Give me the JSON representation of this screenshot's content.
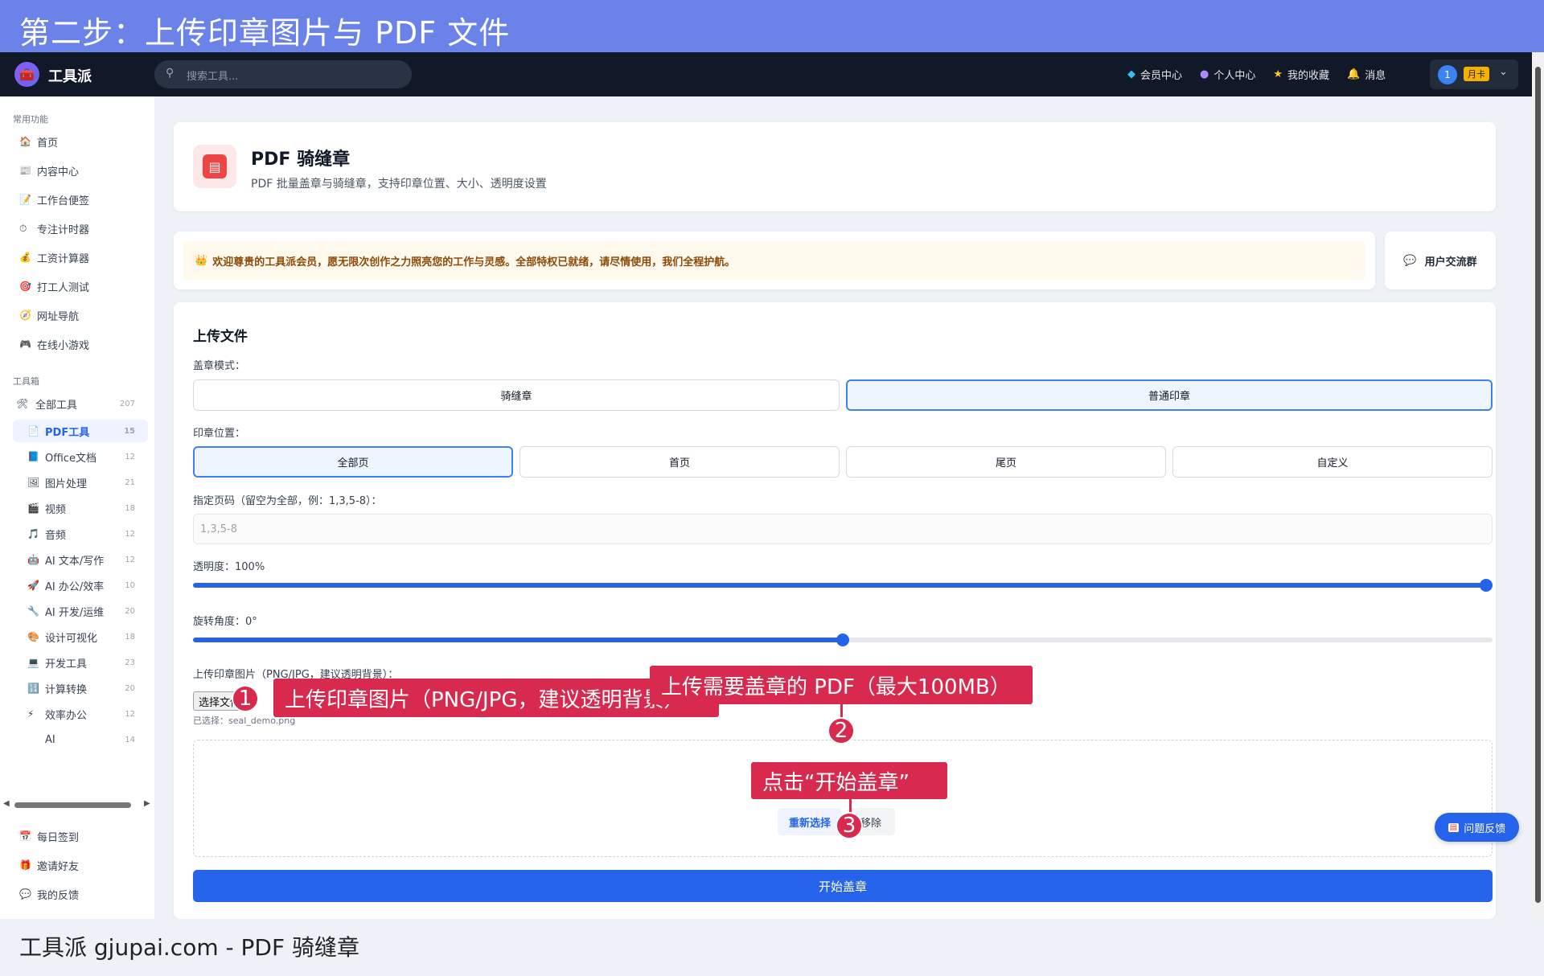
{
  "banner": {
    "title": "第二步：上传印章图片与 PDF 文件"
  },
  "navbar": {
    "app_name": "工具派",
    "search_placeholder": "搜索工具...",
    "links": [
      {
        "label": "会员中心",
        "icon": "diamond-icon"
      },
      {
        "label": "个人中心",
        "icon": "user-icon"
      },
      {
        "label": "我的收藏",
        "icon": "star-icon"
      },
      {
        "label": "消息",
        "icon": "bell-icon"
      }
    ],
    "avatar_text": "1",
    "plan_badge": "月卡"
  },
  "sidebar": {
    "common_title": "常用功能",
    "common": [
      {
        "label": "首页",
        "icon": "🏠"
      },
      {
        "label": "内容中心",
        "icon": "📰"
      },
      {
        "label": "工作台便签",
        "icon": "📝"
      },
      {
        "label": "专注计时器",
        "icon": "⏱"
      },
      {
        "label": "工资计算器",
        "icon": "💰"
      },
      {
        "label": "打工人测试",
        "icon": "🎯"
      },
      {
        "label": "网址导航",
        "icon": "🧭"
      },
      {
        "label": "在线小游戏",
        "icon": "🎮"
      }
    ],
    "toolbox_title": "工具箱",
    "all_tools": {
      "label": "全部工具",
      "count": "207",
      "icon": "🛠"
    },
    "tools": [
      {
        "label": "PDF工具",
        "count": "15",
        "icon": "📄",
        "active": true
      },
      {
        "label": "Office文档",
        "count": "12",
        "icon": "📘"
      },
      {
        "label": "图片处理",
        "count": "21",
        "icon": "🖼"
      },
      {
        "label": "视频",
        "count": "18",
        "icon": "🎬"
      },
      {
        "label": "音频",
        "count": "12",
        "icon": "🎵"
      },
      {
        "label": "AI 文本/写作",
        "count": "12",
        "icon": "🤖"
      },
      {
        "label": "AI 办公/效率",
        "count": "10",
        "icon": "🚀"
      },
      {
        "label": "AI 开发/运维",
        "count": "20",
        "icon": "🔧"
      },
      {
        "label": "设计可视化",
        "count": "18",
        "icon": "🎨"
      },
      {
        "label": "开发工具",
        "count": "23",
        "icon": "💻"
      },
      {
        "label": "计算转换",
        "count": "20",
        "icon": "🔢"
      },
      {
        "label": "效率办公",
        "count": "12",
        "icon": "⚡"
      },
      {
        "label": "AI",
        "count": "14",
        "icon": ""
      }
    ],
    "bottom": [
      {
        "label": "每日签到",
        "icon": "📅"
      },
      {
        "label": "邀请好友",
        "icon": "🎁"
      },
      {
        "label": "我的反馈",
        "icon": "💬"
      }
    ]
  },
  "header_card": {
    "title": "PDF 骑缝章",
    "subtitle": "PDF 批量盖章与骑缝章，支持印章位置、大小、透明度设置"
  },
  "welcome": {
    "text": "欢迎尊贵的工具派会员，愿无限次创作之力照亮您的工作与灵感。全部特权已就绪，请尽情使用，我们全程护航。",
    "group_button": "用户交流群"
  },
  "upload": {
    "section_title": "上传文件",
    "mode_label": "盖章模式：",
    "modes": [
      {
        "label": "骑缝章",
        "selected": false
      },
      {
        "label": "普通印章",
        "selected": true
      }
    ],
    "position_label": "印章位置：",
    "positions": [
      {
        "label": "全部页",
        "selected": true
      },
      {
        "label": "首页",
        "selected": false
      },
      {
        "label": "尾页",
        "selected": false
      },
      {
        "label": "自定义",
        "selected": false
      }
    ],
    "pages_label": "指定页码（留空为全部，例：1,3,5-8）：",
    "pages_placeholder": "1,3,5-8",
    "opacity_label": "透明度：100%",
    "opacity_value": 1.0,
    "rotation_label": "旋转角度：0°",
    "rotation_value": 0.5,
    "seal_label": "上传印章图片（PNG/JPG，建议透明背景）：",
    "choose_file": "选择文件",
    "chosen_file": "已选择：seal_demo.png",
    "reselect": "重新选择",
    "remove": "移除",
    "start": "开始盖章"
  },
  "feedback_button": "问题反馈",
  "annotations": [
    {
      "num": "1",
      "text": "上传印章图片（PNG/JPG，建议透明背景）"
    },
    {
      "num": "2",
      "text": "上传需要盖章的 PDF（最大100MB）"
    },
    {
      "num": "3",
      "text": "点击“开始盖章”"
    }
  ],
  "footer": {
    "text": "工具派 gjupai.com - PDF 骑缝章"
  },
  "colors": {
    "banner": "#6b82e8",
    "primary": "#2563eb",
    "callout": "#d72a4e",
    "navbar": "#111827"
  }
}
